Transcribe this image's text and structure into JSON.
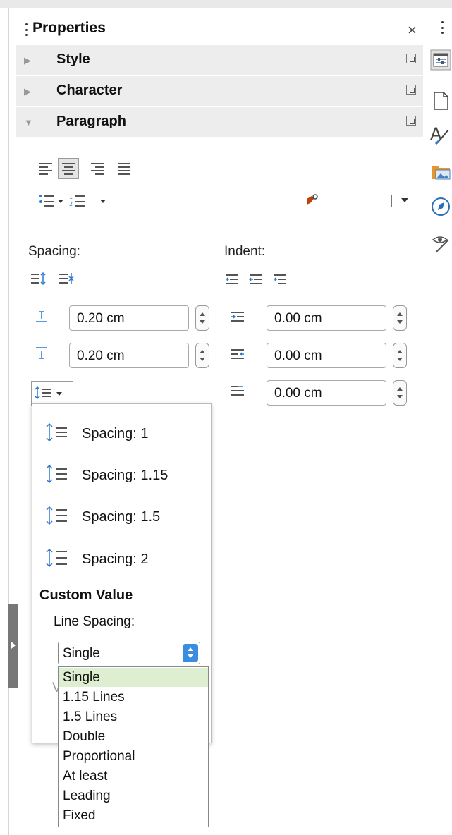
{
  "panel": {
    "title": "Properties",
    "close_glyph": "×",
    "sections": [
      {
        "label": "Style",
        "expanded": false
      },
      {
        "label": "Character",
        "expanded": false
      },
      {
        "label": "Paragraph",
        "expanded": true
      }
    ]
  },
  "paragraph": {
    "alignment_selected": "center",
    "spacing_label": "Spacing:",
    "indent_label": "Indent:",
    "above_spacing": "0.20 cm",
    "below_spacing": "0.20 cm",
    "indent_before": "0.00 cm",
    "indent_after": "0.00 cm",
    "first_line_indent": "0.00 cm"
  },
  "line_spacing_popup": {
    "presets": [
      "Spacing: 1",
      "Spacing: 1.15",
      "Spacing: 1.5",
      "Spacing: 2"
    ],
    "custom_value_label": "Custom Value",
    "line_spacing_label": "Line Spacing:",
    "selected": "Single",
    "partial_value_label": "V",
    "options": [
      "Single",
      "1.15 Lines",
      "1.5 Lines",
      "Double",
      "Proportional",
      "At least",
      "Leading",
      "Fixed"
    ]
  },
  "sidebar_tabs": [
    "properties-icon",
    "page-icon",
    "styles-icon",
    "gallery-icon",
    "navigator-icon",
    "accessibility-icon"
  ],
  "colors": {
    "selected_option": "#ddefd0",
    "combo_button": "#3b8de0",
    "gallery_folder": "#e8962a",
    "navigator": "#2a6fb8"
  }
}
